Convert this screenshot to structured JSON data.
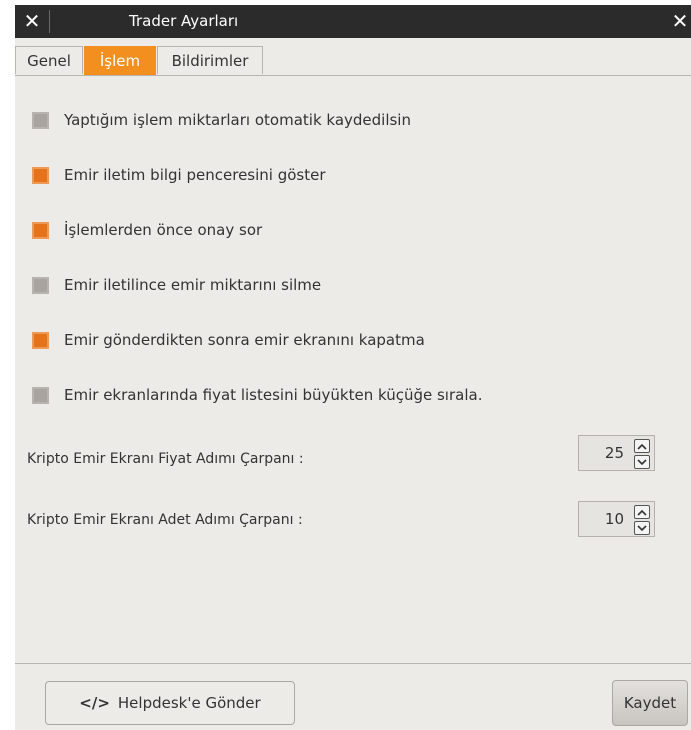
{
  "window": {
    "title": "Trader Ayarları",
    "close_glyph": "✕"
  },
  "tabs": [
    {
      "label": "Genel",
      "active": false
    },
    {
      "label": "İşlem",
      "active": true
    },
    {
      "label": "Bildirimler",
      "active": false
    }
  ],
  "options": [
    {
      "label": "Yaptığım işlem miktarları otomatik kaydedilsin",
      "checked": false
    },
    {
      "label": "Emir iletim bilgi penceresini göster",
      "checked": true
    },
    {
      "label": "İşlemlerden önce onay sor",
      "checked": true
    },
    {
      "label": "Emir iletilince emir miktarını silme",
      "checked": false
    },
    {
      "label": "Emir gönderdikten sonra emir ekranını kapatma",
      "checked": true
    },
    {
      "label": "Emir ekranlarında fiyat listesini büyükten küçüğe sırala.",
      "checked": false
    }
  ],
  "fields": [
    {
      "label": "Kripto Emir Ekranı Fiyat Adımı Çarpanı :",
      "value": "25"
    },
    {
      "label": "Kripto Emir Ekranı Adet Adımı Çarpanı :",
      "value": "10"
    }
  ],
  "footer": {
    "help_icon": "</>",
    "help_label": "Helpdesk'e Gönder",
    "save_label": "Kaydet"
  },
  "colors": {
    "accent": "#f28f1e",
    "checked": "#e5731a",
    "unchecked": "#a9a49f",
    "titlebar": "#2b2b2b",
    "background": "#ecebe8"
  }
}
